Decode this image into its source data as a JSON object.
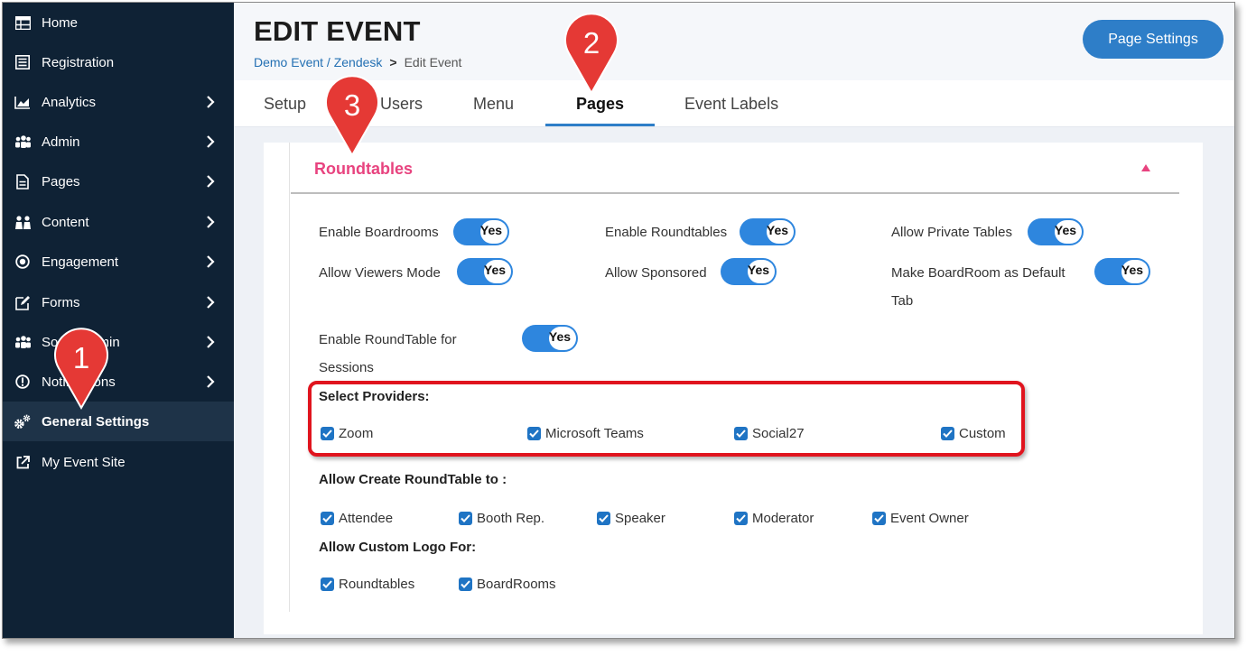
{
  "sidebar": {
    "items": [
      {
        "label": "Home",
        "icon": "table-icon"
      },
      {
        "label": "Registration",
        "icon": "list-icon"
      },
      {
        "label": "Analytics",
        "icon": "chart-icon",
        "has_children": true
      },
      {
        "label": "Admin",
        "icon": "users-icon",
        "has_children": true
      },
      {
        "label": "Pages",
        "icon": "document-icon",
        "has_children": true
      },
      {
        "label": "Content",
        "icon": "people-icon",
        "has_children": true
      },
      {
        "label": "Engagement",
        "icon": "target-icon",
        "has_children": true
      },
      {
        "label": "Forms",
        "icon": "edit-icon",
        "has_children": true
      },
      {
        "label": "Social Admin",
        "label_visible": "Sonal Admin",
        "icon": "users-icon",
        "has_children": true
      },
      {
        "label": "Notifications",
        "label_visible": "Notifications",
        "icon": "alert-icon",
        "has_children": true
      },
      {
        "label": "General Settings",
        "icon": "gears-icon",
        "active": true
      },
      {
        "label": "My Event Site",
        "icon": "external-link-icon"
      }
    ]
  },
  "header": {
    "title": "EDIT EVENT",
    "breadcrumb_link": "Demo Event / Zendesk",
    "breadcrumb_sep": ">",
    "breadcrumb_current": "Edit Event",
    "page_settings_label": "Page Settings"
  },
  "tabs": [
    {
      "label": "Setup"
    },
    {
      "label": "Users"
    },
    {
      "label": "Menu"
    },
    {
      "label": "Pages",
      "active": true
    },
    {
      "label": "Event Labels"
    }
  ],
  "section": {
    "title": "Roundtables",
    "options": [
      {
        "label": "Enable Boardrooms",
        "value": "Yes"
      },
      {
        "label": "Enable Roundtables",
        "value": "Yes"
      },
      {
        "label": "Allow Private Tables",
        "value": "Yes"
      },
      {
        "label": "Allow Viewers Mode",
        "value": "Yes"
      },
      {
        "label": "Allow Sponsored",
        "value": "Yes"
      },
      {
        "label_line1": "Make BoardRoom as Default",
        "label_line2": "Tab",
        "value": "Yes"
      },
      {
        "label_line1": "Enable RoundTable for",
        "label_line2": "Sessions",
        "value": "Yes"
      }
    ],
    "providers_label": "Select Providers:",
    "providers": [
      {
        "label": "Zoom",
        "checked": true
      },
      {
        "label": "Microsoft Teams",
        "checked": true
      },
      {
        "label": "Social27",
        "checked": true
      },
      {
        "label": "Custom",
        "checked": true
      }
    ],
    "allow_create_label": "Allow Create RoundTable to :",
    "allow_create": [
      {
        "label": "Attendee",
        "checked": true
      },
      {
        "label": "Booth Rep.",
        "checked": true
      },
      {
        "label": "Speaker",
        "checked": true
      },
      {
        "label": "Moderator",
        "checked": true
      },
      {
        "label": "Event Owner",
        "checked": true
      }
    ],
    "custom_logo_label": "Allow Custom Logo For:",
    "custom_logo": [
      {
        "label": "Roundtables",
        "checked": true
      },
      {
        "label": "BoardRooms",
        "checked": true
      }
    ]
  },
  "callouts": [
    "1",
    "2",
    "3"
  ],
  "colors": {
    "sidebar_bg": "#0f2235",
    "accent": "#2e7ec8",
    "section_title": "#e8437f",
    "highlight": "#e0141e",
    "callout": "#e53935"
  }
}
